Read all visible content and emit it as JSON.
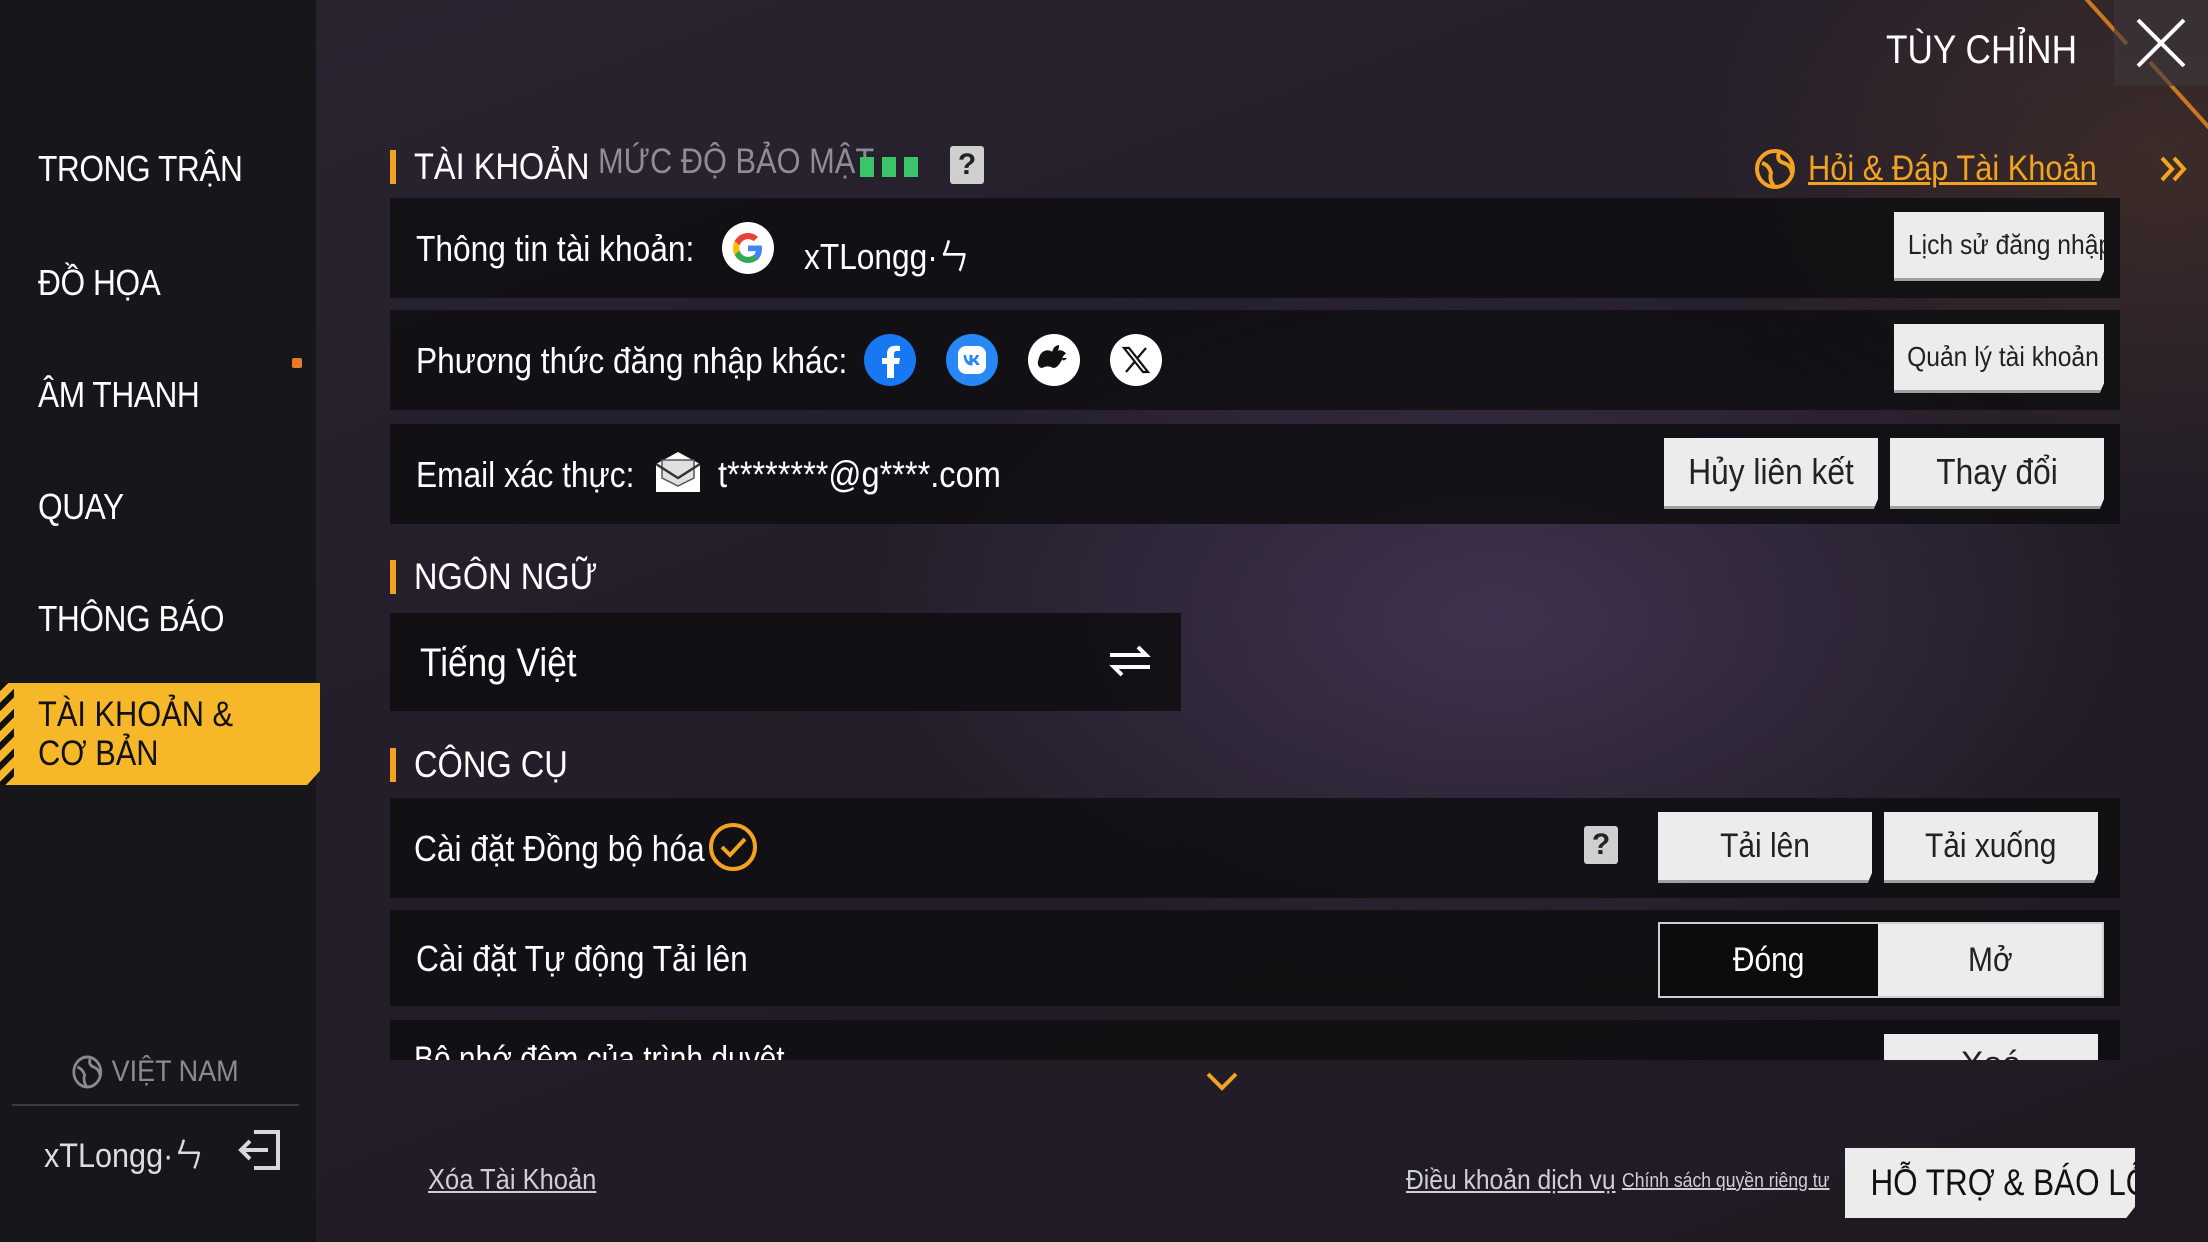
{
  "header": {
    "title": "TÙY CHỈNH"
  },
  "sidebar": {
    "items": [
      {
        "label": "TRONG TRẬN"
      },
      {
        "label": "ĐỒ HỌA"
      },
      {
        "label": "ÂM THANH"
      },
      {
        "label": "QUAY"
      },
      {
        "label": "THÔNG BÁO"
      },
      {
        "label": "TÀI KHOẢN & CƠ BẢN",
        "active": true
      }
    ],
    "region": "VIỆT NAM",
    "username": "xTLongg·ㄣ"
  },
  "account": {
    "section_title": "TÀI KHOẢN",
    "security_label": "MỨC ĐỘ BẢO MẬT",
    "security_level": 3,
    "faq_link": "Hỏi & Đáp Tài Khoản",
    "info_label": "Thông tin tài khoản:",
    "account_name": "xTLongg·ㄣ",
    "login_history_button": "Lịch sử đăng nhập",
    "other_login_label": "Phương thức đăng nhập khác:",
    "social_providers": [
      "facebook-icon",
      "vk-icon",
      "apple-icon",
      "x-icon"
    ],
    "manage_account_button": "Quản lý tài khoản",
    "email_label": "Email xác thực:",
    "email_value": "t********@g****.com",
    "unlink_button": "Hủy liên kết",
    "change_button": "Thay đổi"
  },
  "language": {
    "section_title": "NGÔN NGỮ",
    "current": "Tiếng Việt"
  },
  "tools": {
    "section_title": "CÔNG CỤ",
    "sync_label": "Cài đặt Đồng bộ hóa",
    "upload_button": "Tải lên",
    "download_button": "Tải xuống",
    "auto_upload_label": "Cài đặt Tự động Tải lên",
    "toggle_off": "Đóng",
    "toggle_on": "Mở",
    "toggle_selected": "Đóng",
    "partial_row_label": "Bộ nhớ đệm của trình duyệt",
    "partial_row_button": "Xoá"
  },
  "footer": {
    "delete_account": "Xóa Tài Khoản",
    "terms": "Điều khoản dịch vụ",
    "privacy": "Chính sách quyền riêng tư",
    "support_button": "HỖ TRỢ & BÁO LỖI"
  },
  "colors": {
    "accent": "#f4a321",
    "active_nav": "#f6b728",
    "security_bar": "#3cc46a",
    "panel": "#0e0d10"
  }
}
